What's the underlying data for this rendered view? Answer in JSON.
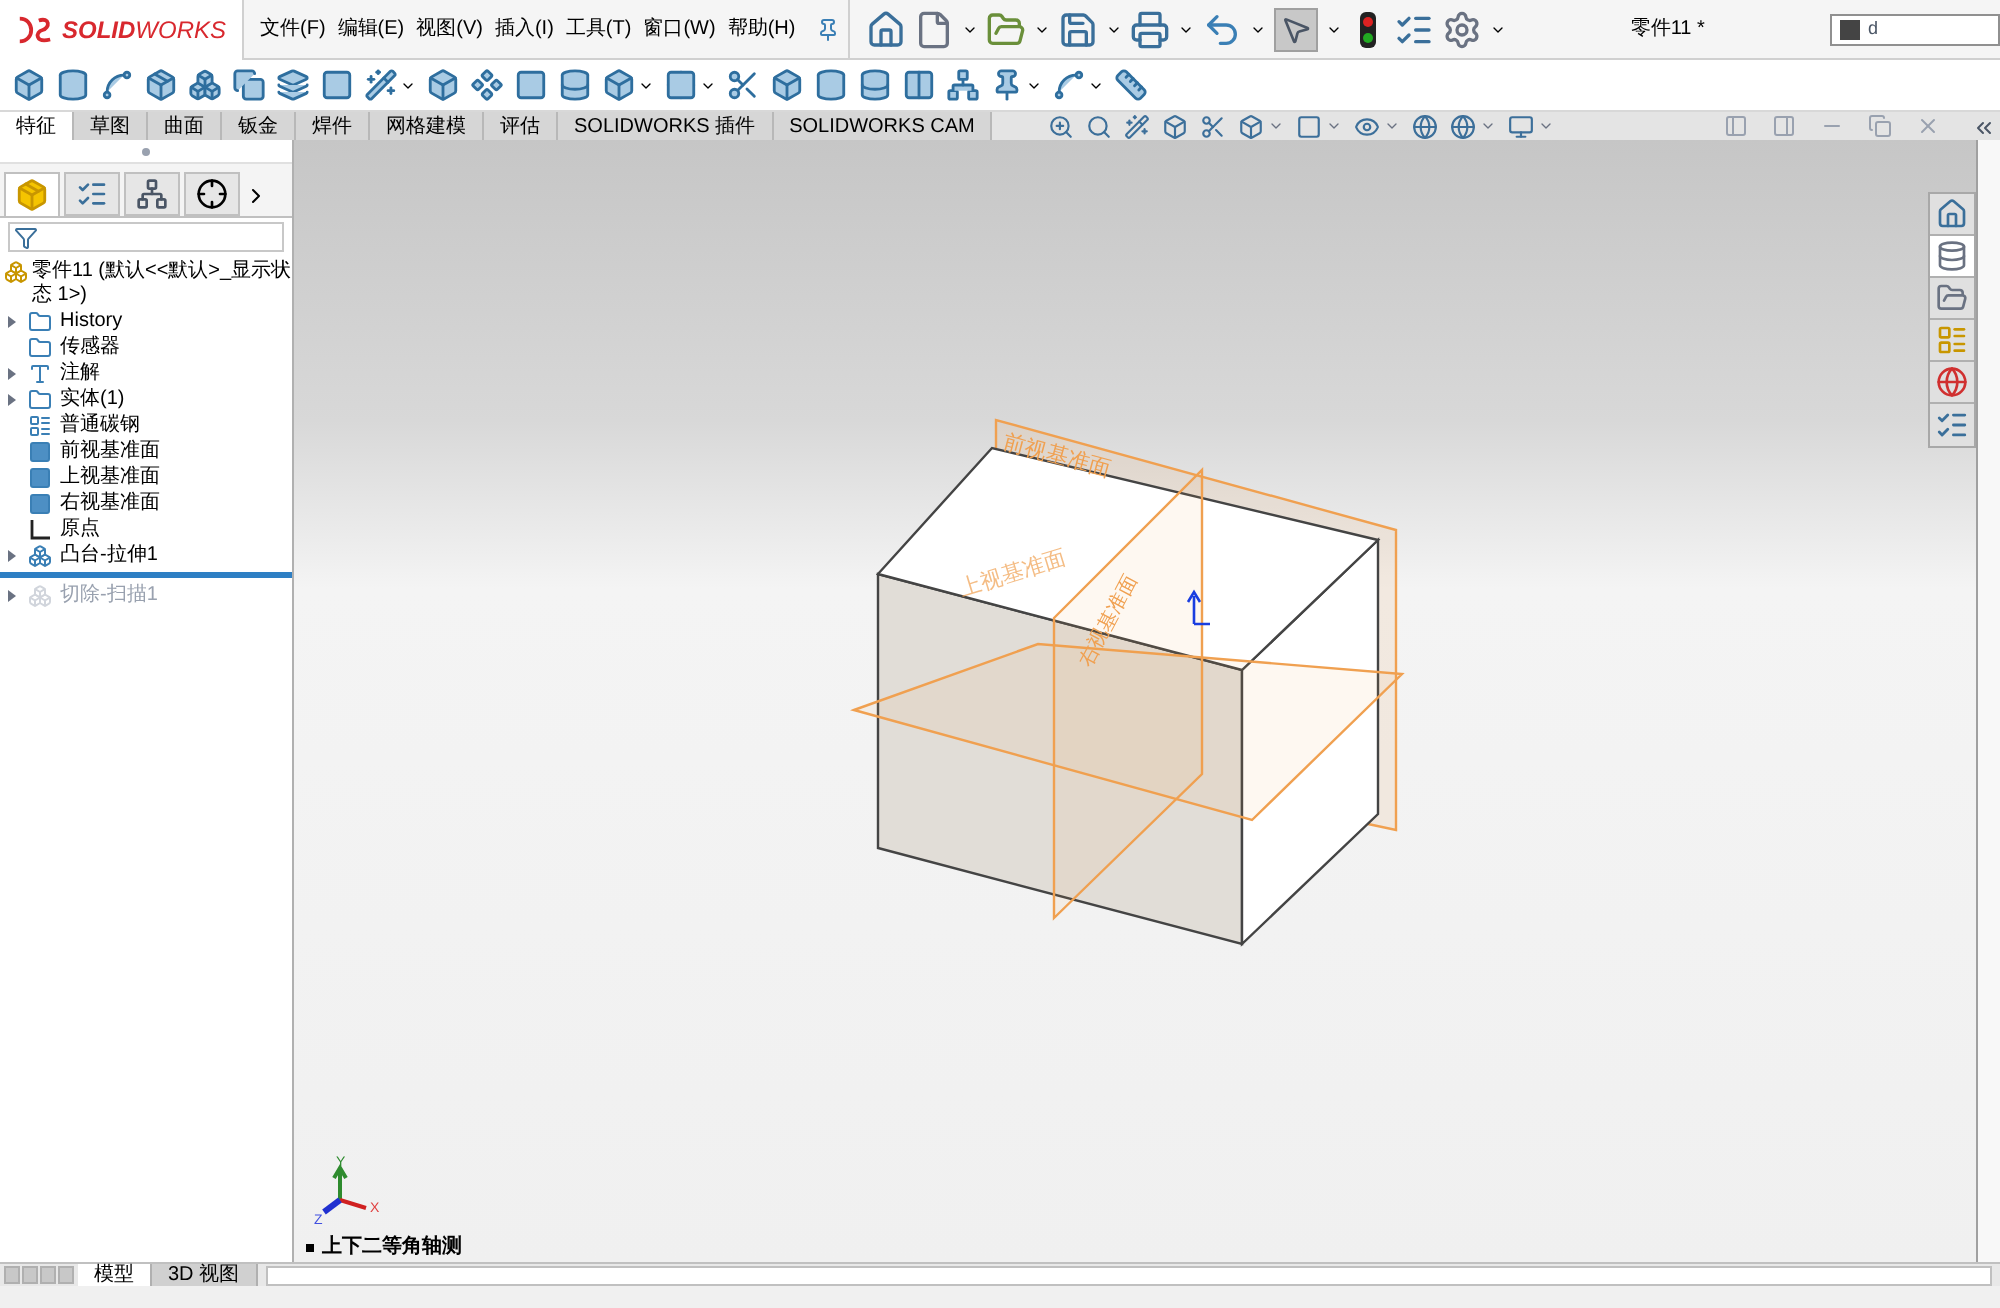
{
  "logo": {
    "text": "**SOLID**WORKS"
  },
  "menu": [
    "文件(F)",
    "编辑(E)",
    "视图(V)",
    "插入(I)",
    "工具(T)",
    "窗口(W)",
    "帮助(H)"
  ],
  "document_title": "零件11 *",
  "search": {
    "value": "d"
  },
  "command_tabs": [
    {
      "label": "特征",
      "selected": true
    },
    {
      "label": "草图",
      "selected": false
    },
    {
      "label": "曲面",
      "selected": false
    },
    {
      "label": "钣金",
      "selected": false
    },
    {
      "label": "焊件",
      "selected": false
    },
    {
      "label": "网格建模",
      "selected": false
    },
    {
      "label": "评估",
      "selected": false
    },
    {
      "label": "SOLIDWORKS 插件",
      "selected": false
    },
    {
      "label": "SOLIDWORKS CAM",
      "selected": false
    }
  ],
  "feature_tree": {
    "root": "零件11  (默认<<默认>_显示状态 1>)",
    "items": [
      {
        "label": "History",
        "kind": "folder",
        "expandable": true,
        "suppressed": false
      },
      {
        "label": "传感器",
        "kind": "folder",
        "expandable": false,
        "suppressed": false
      },
      {
        "label": "注解",
        "kind": "annotation",
        "expandable": true,
        "suppressed": false
      },
      {
        "label": "实体(1)",
        "kind": "folder",
        "expandable": true,
        "suppressed": false
      },
      {
        "label": "普通碳钢",
        "kind": "material",
        "expandable": false,
        "suppressed": false
      },
      {
        "label": "前视基准面",
        "kind": "plane",
        "expandable": false,
        "suppressed": false
      },
      {
        "label": "上视基准面",
        "kind": "plane",
        "expandable": false,
        "suppressed": false
      },
      {
        "label": "右视基准面",
        "kind": "plane",
        "expandable": false,
        "suppressed": false
      },
      {
        "label": "原点",
        "kind": "origin",
        "expandable": false,
        "suppressed": false
      },
      {
        "label": "凸台-拉伸1",
        "kind": "feature",
        "expandable": true,
        "suppressed": false
      },
      {
        "kind": "rollback"
      },
      {
        "label": "切除-扫描1",
        "kind": "feature",
        "expandable": true,
        "suppressed": true
      }
    ]
  },
  "viewport": {
    "plane_labels": [
      "前视基准面",
      "上视基准面",
      "右视基准面"
    ],
    "triad": [
      "X",
      "Y",
      "Z"
    ],
    "view_name": "上下二等角轴测"
  },
  "bottom_tabs": [
    {
      "label": "模型",
      "selected": true
    },
    {
      "label": "3D 视图",
      "selected": false
    }
  ]
}
